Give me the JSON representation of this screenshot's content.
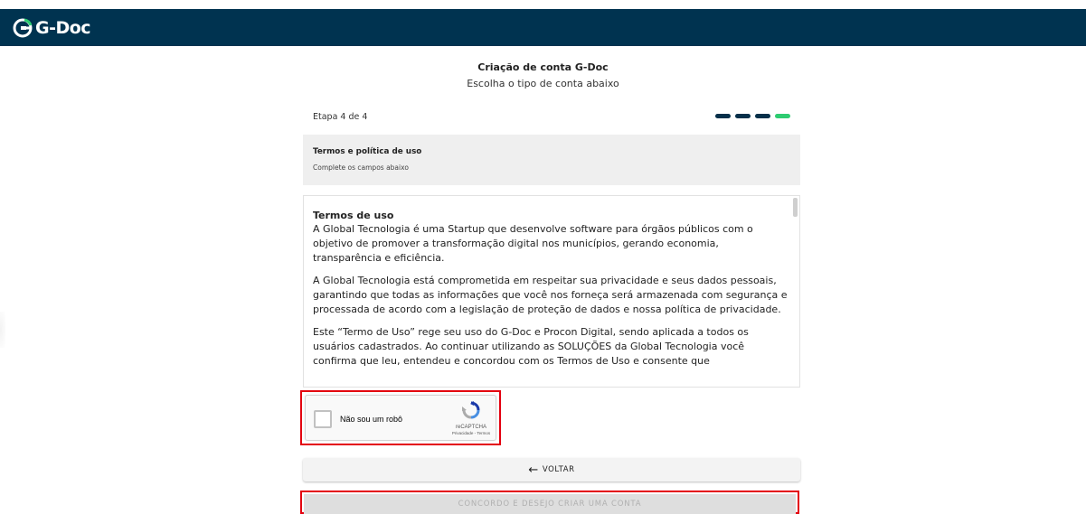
{
  "app": {
    "logo_text": "G-Doc"
  },
  "header": {
    "title": "Criação de conta G-Doc",
    "subtitle": "Escolha o tipo de conta abaixo"
  },
  "progress": {
    "label": "Etapa 4 de 4",
    "current_step": 4,
    "total_steps": 4,
    "colors": {
      "done": "#06304a",
      "active": "#2ecc71"
    }
  },
  "section": {
    "title": "Termos e política de uso",
    "subtitle": "Complete os campos abaixo"
  },
  "terms": {
    "heading": "Termos de uso",
    "paragraphs": [
      "A Global Tecnologia é uma Startup que desenvolve software para órgãos públicos com o objetivo de promover a transformação digital nos municípios, gerando economia, transparência e eficiência.",
      "A Global Tecnologia está comprometida em respeitar sua privacidade e seus dados pessoais, garantindo que todas as informações que você nos forneça será armazenada com segurança e processada de acordo com a legislação de proteção de dados e nossa política de privacidade.",
      "Este “Termo de Uso” rege seu uso do G-Doc e Procon Digital, sendo aplicada a todos os usuários cadastrados. Ao continuar utilizando as SOLUÇÕES da Global Tecnologia você confirma que leu, entendeu e concordou com os Termos de Uso e consente que"
    ]
  },
  "captcha": {
    "label": "Não sou um robô",
    "brand": "reCAPTCHA",
    "links": "Privacidade - Termos",
    "checked": false
  },
  "buttons": {
    "back": "VOLTAR",
    "agree": "CONCORDO E DESEJO CRIAR UMA CONTA"
  },
  "colors": {
    "topbar": "#003350",
    "highlight": "#e3000f"
  }
}
